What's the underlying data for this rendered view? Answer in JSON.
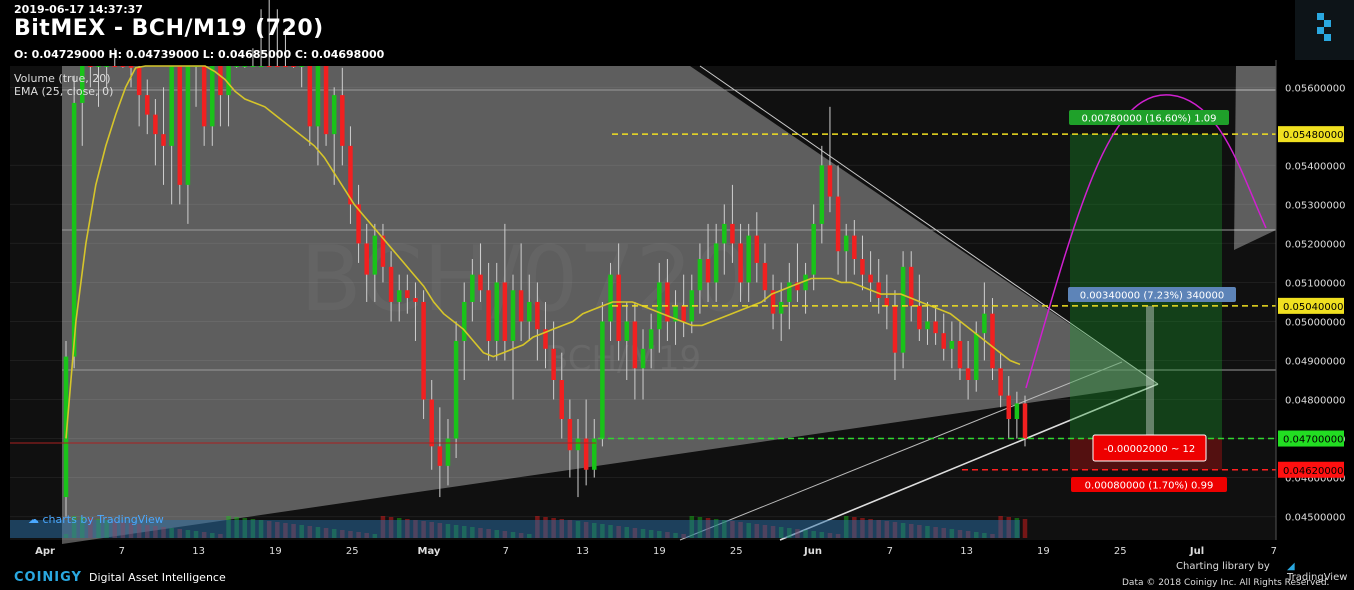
{
  "header": {
    "timestamp": "2019-06-17 14:37:37",
    "title": "BitMEX - BCH/M19 (720)",
    "ohlc": "O: 0.04729000 H: 0.04739000 L: 0.04685000 C: 0.04698000"
  },
  "indicators": {
    "volume": "Volume (true, 20)",
    "ema": "EMA (25, close, 0)"
  },
  "watermark": {
    "line1": "BCH/0720",
    "line2": "BCH/M19"
  },
  "tradingview_mark": "charts by TradingView",
  "footer": {
    "brand": "COINIGY",
    "tagline": "Digital Asset Intelligence",
    "charting_library": "Charting library by",
    "tradingview": "TradingView",
    "copyright": "Data © 2018     Coinigy Inc. All Rights Reserved."
  },
  "colors": {
    "up": "#19c319",
    "down": "#f22020",
    "ema": "#d6c52a",
    "level_yellow": "#f0e020",
    "level_green": "#30d530",
    "level_red": "#ff2020",
    "label_blue": "#5d84b8",
    "label_green": "#1fa12a",
    "label_red": "#ee0000",
    "arc": "#d020d0"
  },
  "chart_data": {
    "type": "candlestick",
    "x_ticks": [
      "Apr",
      "7",
      "13",
      "19",
      "25",
      "May",
      "7",
      "13",
      "19",
      "25",
      "Jun",
      "7",
      "13",
      "19",
      "25",
      "Jul",
      "7"
    ],
    "y_ticks": [
      "0.05600000",
      "0.05400000",
      "0.05300000",
      "0.05200000",
      "0.05100000",
      "0.05000000",
      "0.04900000",
      "0.04800000",
      "0.04700000",
      "0.04600000",
      "0.04500000"
    ],
    "ylim": [
      0.0444,
      0.0567
    ],
    "price_levels": [
      {
        "label": "0.05480000",
        "value": 0.0548,
        "style": "yellow-dashed"
      },
      {
        "label": "0.05040000",
        "value": 0.0504,
        "style": "yellow-dashed"
      },
      {
        "label": "0.04700000",
        "value": 0.047,
        "style": "green-dashed"
      },
      {
        "label": "0.04620000",
        "value": 0.0462,
        "style": "red-dashed"
      }
    ],
    "annotations": [
      {
        "text": "0.00780000 (16.60%) 1.09",
        "kind": "target-green"
      },
      {
        "text": "0.00340000 (7.23%) 340000",
        "kind": "measure-blue"
      },
      {
        "text": "-0.00002000 ~ 12",
        "kind": "entry-red"
      },
      {
        "text": "0.00080000 (1.70%) 0.99",
        "kind": "stop-red"
      }
    ],
    "candles": [
      [
        0.0455,
        0.0495,
        0.045,
        0.0491
      ],
      [
        0.0491,
        0.0563,
        0.0488,
        0.0556
      ],
      [
        0.0556,
        0.06,
        0.0545,
        0.0575
      ],
      [
        0.0575,
        0.058,
        0.056,
        0.0568
      ],
      [
        0.0568,
        0.0575,
        0.0555,
        0.057
      ],
      [
        0.057,
        0.06,
        0.056,
        0.059
      ],
      [
        0.059,
        0.06,
        0.057,
        0.058
      ],
      [
        0.058,
        0.0585,
        0.0565,
        0.0572
      ],
      [
        0.0572,
        0.0578,
        0.056,
        0.0565
      ],
      [
        0.0565,
        0.057,
        0.055,
        0.0558
      ],
      [
        0.0558,
        0.0562,
        0.0548,
        0.0553
      ],
      [
        0.0553,
        0.0557,
        0.054,
        0.0548
      ],
      [
        0.0548,
        0.056,
        0.0535,
        0.0545
      ],
      [
        0.0545,
        0.06,
        0.053,
        0.0575
      ],
      [
        0.0575,
        0.058,
        0.053,
        0.0535
      ],
      [
        0.0535,
        0.058,
        0.0525,
        0.057
      ],
      [
        0.057,
        0.06,
        0.0555,
        0.0575
      ],
      [
        0.0575,
        0.058,
        0.0545,
        0.055
      ],
      [
        0.055,
        0.0575,
        0.0545,
        0.0568
      ],
      [
        0.0568,
        0.059,
        0.055,
        0.0558
      ],
      [
        0.0558,
        0.0585,
        0.055,
        0.0575
      ],
      [
        0.0575,
        0.059,
        0.0565,
        0.058
      ],
      [
        0.058,
        0.06,
        0.0565,
        0.0585
      ],
      [
        0.0585,
        0.0595,
        0.057,
        0.059
      ],
      [
        0.059,
        0.06,
        0.058,
        0.0595
      ],
      [
        0.0595,
        0.06,
        0.0585,
        0.0592
      ],
      [
        0.0592,
        0.06,
        0.058,
        0.0588
      ],
      [
        0.0588,
        0.0595,
        0.0575,
        0.0582
      ],
      [
        0.0582,
        0.059,
        0.0565,
        0.057
      ],
      [
        0.057,
        0.0585,
        0.056,
        0.0575
      ],
      [
        0.0575,
        0.058,
        0.0545,
        0.055
      ],
      [
        0.055,
        0.0575,
        0.054,
        0.057
      ],
      [
        0.057,
        0.058,
        0.0545,
        0.0548
      ],
      [
        0.0548,
        0.056,
        0.0535,
        0.0558
      ],
      [
        0.0558,
        0.0565,
        0.054,
        0.0545
      ],
      [
        0.0545,
        0.055,
        0.0525,
        0.053
      ],
      [
        0.053,
        0.0535,
        0.0515,
        0.052
      ],
      [
        0.052,
        0.0525,
        0.0505,
        0.0512
      ],
      [
        0.0512,
        0.0525,
        0.0505,
        0.0522
      ],
      [
        0.0522,
        0.0525,
        0.051,
        0.0514
      ],
      [
        0.0514,
        0.0518,
        0.05,
        0.0505
      ],
      [
        0.0505,
        0.0512,
        0.05,
        0.0508
      ],
      [
        0.0508,
        0.0512,
        0.0502,
        0.0506
      ],
      [
        0.0506,
        0.051,
        0.0495,
        0.0505
      ],
      [
        0.0505,
        0.0508,
        0.0475,
        0.048
      ],
      [
        0.048,
        0.0485,
        0.0462,
        0.0468
      ],
      [
        0.0468,
        0.0478,
        0.0455,
        0.0463
      ],
      [
        0.0463,
        0.0475,
        0.0458,
        0.047
      ],
      [
        0.047,
        0.05,
        0.0465,
        0.0495
      ],
      [
        0.0495,
        0.051,
        0.0485,
        0.0505
      ],
      [
        0.0505,
        0.0516,
        0.05,
        0.0512
      ],
      [
        0.0512,
        0.052,
        0.0505,
        0.0508
      ],
      [
        0.0508,
        0.0515,
        0.049,
        0.0495
      ],
      [
        0.0495,
        0.0515,
        0.049,
        0.051
      ],
      [
        0.051,
        0.0525,
        0.049,
        0.0495
      ],
      [
        0.0495,
        0.0512,
        0.048,
        0.0508
      ],
      [
        0.0508,
        0.052,
        0.0495,
        0.05
      ],
      [
        0.05,
        0.0512,
        0.0495,
        0.0505
      ],
      [
        0.0505,
        0.051,
        0.049,
        0.0498
      ],
      [
        0.0498,
        0.0505,
        0.0488,
        0.0493
      ],
      [
        0.0493,
        0.05,
        0.048,
        0.0485
      ],
      [
        0.0485,
        0.0492,
        0.047,
        0.0475
      ],
      [
        0.0475,
        0.048,
        0.046,
        0.0467
      ],
      [
        0.0467,
        0.0475,
        0.0455,
        0.047
      ],
      [
        0.047,
        0.048,
        0.0458,
        0.0462
      ],
      [
        0.0462,
        0.0475,
        0.046,
        0.047
      ],
      [
        0.047,
        0.0505,
        0.0468,
        0.05
      ],
      [
        0.05,
        0.0515,
        0.0495,
        0.0512
      ],
      [
        0.0512,
        0.052,
        0.049,
        0.0495
      ],
      [
        0.0495,
        0.0505,
        0.0485,
        0.05
      ],
      [
        0.05,
        0.0505,
        0.048,
        0.0488
      ],
      [
        0.0488,
        0.0498,
        0.048,
        0.0493
      ],
      [
        0.0493,
        0.0502,
        0.0488,
        0.0498
      ],
      [
        0.0498,
        0.0515,
        0.0492,
        0.051
      ],
      [
        0.051,
        0.0516,
        0.0495,
        0.05
      ],
      [
        0.05,
        0.0508,
        0.0494,
        0.0504
      ],
      [
        0.0504,
        0.0512,
        0.0496,
        0.05
      ],
      [
        0.05,
        0.0512,
        0.0497,
        0.0508
      ],
      [
        0.0508,
        0.052,
        0.0502,
        0.0516
      ],
      [
        0.0516,
        0.0525,
        0.0505,
        0.051
      ],
      [
        0.051,
        0.0525,
        0.0505,
        0.052
      ],
      [
        0.052,
        0.053,
        0.0512,
        0.0525
      ],
      [
        0.0525,
        0.0535,
        0.0515,
        0.052
      ],
      [
        0.052,
        0.0525,
        0.0505,
        0.051
      ],
      [
        0.051,
        0.0525,
        0.0505,
        0.0522
      ],
      [
        0.0522,
        0.0528,
        0.051,
        0.0515
      ],
      [
        0.0515,
        0.052,
        0.0505,
        0.0508
      ],
      [
        0.0508,
        0.0512,
        0.0498,
        0.0502
      ],
      [
        0.0502,
        0.051,
        0.0495,
        0.0505
      ],
      [
        0.0505,
        0.0515,
        0.0498,
        0.051
      ],
      [
        0.051,
        0.052,
        0.0505,
        0.0508
      ],
      [
        0.0508,
        0.0515,
        0.0502,
        0.0512
      ],
      [
        0.0512,
        0.053,
        0.0508,
        0.0525
      ],
      [
        0.0525,
        0.0545,
        0.052,
        0.054
      ],
      [
        0.054,
        0.0555,
        0.0528,
        0.0532
      ],
      [
        0.0532,
        0.054,
        0.0512,
        0.0518
      ],
      [
        0.0518,
        0.0525,
        0.051,
        0.0522
      ],
      [
        0.0522,
        0.0526,
        0.0512,
        0.0516
      ],
      [
        0.0516,
        0.0522,
        0.0508,
        0.0512
      ],
      [
        0.0512,
        0.0518,
        0.0505,
        0.051
      ],
      [
        0.051,
        0.0516,
        0.0502,
        0.0506
      ],
      [
        0.0506,
        0.0512,
        0.0498,
        0.0504
      ],
      [
        0.0504,
        0.0508,
        0.0485,
        0.0492
      ],
      [
        0.0492,
        0.0518,
        0.0488,
        0.0514
      ],
      [
        0.0514,
        0.0518,
        0.05,
        0.0504
      ],
      [
        0.0504,
        0.0512,
        0.0495,
        0.0498
      ],
      [
        0.0498,
        0.0505,
        0.0494,
        0.05
      ],
      [
        0.05,
        0.0504,
        0.0494,
        0.0497
      ],
      [
        0.0497,
        0.0502,
        0.049,
        0.0493
      ],
      [
        0.0493,
        0.05,
        0.0488,
        0.0495
      ],
      [
        0.0495,
        0.05,
        0.0485,
        0.0488
      ],
      [
        0.0488,
        0.0495,
        0.048,
        0.0485
      ],
      [
        0.0485,
        0.05,
        0.0482,
        0.0497
      ],
      [
        0.0497,
        0.051,
        0.049,
        0.0502
      ],
      [
        0.0502,
        0.0506,
        0.0485,
        0.0488
      ],
      [
        0.0488,
        0.0492,
        0.0478,
        0.0481
      ],
      [
        0.0481,
        0.0486,
        0.047,
        0.0475
      ],
      [
        0.0475,
        0.0482,
        0.047,
        0.0479
      ],
      [
        0.0479,
        0.0481,
        0.0468,
        0.047
      ]
    ],
    "ema": [
      0.047,
      0.05,
      0.052,
      0.0535,
      0.0545,
      0.0553,
      0.056,
      0.0565,
      0.0568,
      0.057,
      0.0571,
      0.0571,
      0.057,
      0.0569,
      0.0566,
      0.0564,
      0.0562,
      0.0559,
      0.0557,
      0.0556,
      0.0555,
      0.0553,
      0.0551,
      0.0549,
      0.0547,
      0.0545,
      0.0542,
      0.0538,
      0.0534,
      0.053,
      0.0527,
      0.0524,
      0.0521,
      0.0518,
      0.0515,
      0.0512,
      0.0509,
      0.0505,
      0.0502,
      0.05,
      0.0498,
      0.0495,
      0.0492,
      0.0491,
      0.0492,
      0.0493,
      0.0494,
      0.0496,
      0.0497,
      0.0498,
      0.0499,
      0.05,
      0.0502,
      0.0503,
      0.0504,
      0.0505,
      0.0505,
      0.0505,
      0.0504,
      0.0503,
      0.0502,
      0.0501,
      0.05,
      0.0499,
      0.0499,
      0.05,
      0.0501,
      0.0502,
      0.0503,
      0.0504,
      0.0505,
      0.0507,
      0.0508,
      0.0509,
      0.051,
      0.0511,
      0.0511,
      0.0511,
      0.051,
      0.051,
      0.0509,
      0.0508,
      0.0507,
      0.0507,
      0.0507,
      0.0506,
      0.0505,
      0.0504,
      0.0503,
      0.0502,
      0.05,
      0.0498,
      0.0496,
      0.0494,
      0.0492,
      0.049,
      0.0489
    ]
  }
}
